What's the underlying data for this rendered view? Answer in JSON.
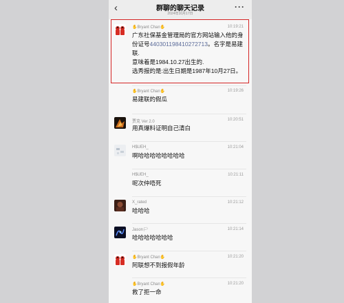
{
  "header": {
    "back_icon": "‹",
    "title": "群聊的聊天记录",
    "subtitle": "2024年10月17日",
    "more_icon": "···"
  },
  "messages": [
    {
      "sender": "Bryant Chan",
      "time": "10:19:21",
      "lines": [
        "广东社保基金管理局的官方网站输入他的身",
        "份证号",
        "。名字是易建",
        "联.",
        "意味着是1984.10.27出生的.",
        "选秀报的是:出生日期是1987年10月27日。"
      ],
      "id_number": "440301198410272713",
      "highlighted": true
    },
    {
      "sender": "Bryant Chan",
      "time": "10:19:26",
      "text": "易建联的假瓜"
    },
    {
      "sender": "贾克 Ver 2.0",
      "time": "10:20:51",
      "text": "用真爆料证明自己清白"
    },
    {
      "sender": "H$UEH_",
      "time": "10:21:04",
      "text": "啊哈哈哈哈哈哈哈哈"
    },
    {
      "sender": "H$UEH_",
      "time": "10:21:11",
      "text": "呢次仲唔死"
    },
    {
      "sender": "X_rated",
      "time": "10:21:12",
      "text": "哈哈哈"
    },
    {
      "sender": "Jason",
      "time": "10:21:14",
      "text": "哈哈哈哈哈哈哈"
    },
    {
      "sender": "Bryant Chan",
      "time": "10:21:20",
      "text": "阿联想不到报假年龄"
    },
    {
      "sender": "Bryant Chan",
      "time": "10:21:20",
      "text": "救了拒一命"
    }
  ],
  "colors": {
    "highlight_border": "#d42424",
    "id_number_link": "#5b6b99"
  },
  "icons": {
    "hand": "✋",
    "flag": "🏳"
  }
}
